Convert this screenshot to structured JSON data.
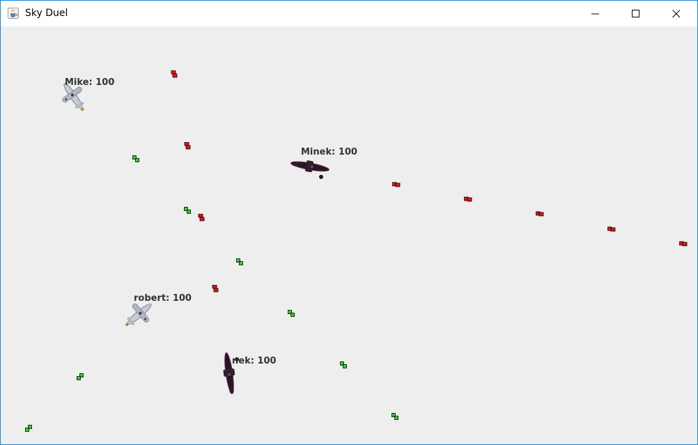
{
  "window": {
    "title": "Sky Duel",
    "icon": "java-coffee-cup-icon",
    "controls": [
      "minimize-icon",
      "maximize-icon",
      "close-icon"
    ]
  },
  "players": [
    {
      "id": "mike",
      "label": "Mike: 100",
      "color": "#c8ccd2",
      "heading": "down-right"
    },
    {
      "id": "minek-top",
      "label": "Minek: 100",
      "color": "#1f1a24",
      "heading": "right"
    },
    {
      "id": "robert",
      "label": "robert: 100",
      "color": "#c8ccd2",
      "heading": "down-left"
    },
    {
      "id": "minek-bottom",
      "label": "nek: 100",
      "color": "#1f1a24",
      "heading": "down"
    }
  ],
  "colors": {
    "red_flag": "#e01818",
    "green_flag": "#2fd42f",
    "background": "#eeeeee"
  }
}
